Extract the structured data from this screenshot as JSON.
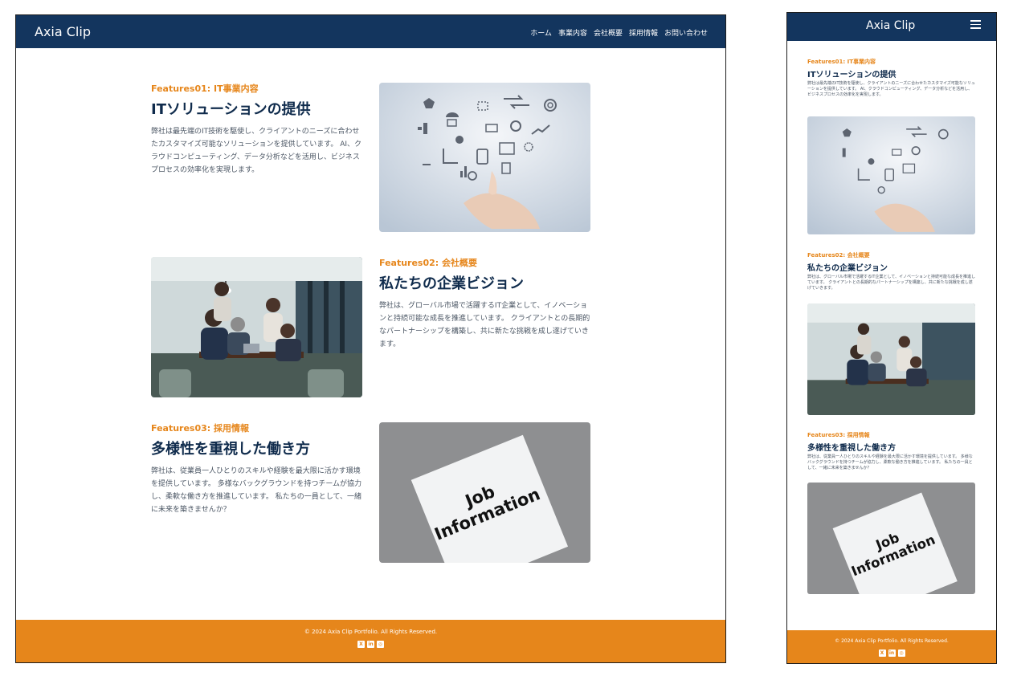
{
  "site": {
    "logo": "Axia Clip",
    "nav": [
      "ホーム",
      "事業内容",
      "会社概要",
      "採用情報",
      "お問い合わせ"
    ],
    "footer_copy": "© 2024 Axia Clip Portfolio. All Rights Reserved.",
    "social_icons": [
      "x-icon",
      "linkedin-icon",
      "github-icon"
    ]
  },
  "features": [
    {
      "kicker": "Features01: IT事業内容",
      "title": "ITソリューションの提供",
      "body": "弊社は最先端のIT技術を駆使し、クライアントのニーズに合わせたカスタマイズ可能なソリューションを提供しています。 AI、クラウドコンピューティング、データ分析などを活用し、ビジネスプロセスの効率化を実現します。",
      "image": "hand-with-tech-icons"
    },
    {
      "kicker": "Features02: 会社概要",
      "title": "私たちの企業ビジョン",
      "body": "弊社は、グローバル市場で活躍するIT企業として、イノベーションと持続可能な成長を推進しています。 クライアントとの長期的なパートナーシップを構築し、共に新たな挑戦を成し遂げていきます。",
      "image": "business-team-photo"
    },
    {
      "kicker": "Features03: 採用情報",
      "title": "多様性を重視した働き方",
      "body": "弊社は、従業員一人ひとりのスキルや経験を最大限に活かす環境を提供しています。 多様なバックグラウンドを持つチームが協力し、柔軟な働き方を推進しています。 私たちの一員として、一緒に未来を築きませんか？",
      "image": "job-information-paper",
      "image_text": [
        "Job",
        "Information"
      ]
    }
  ],
  "colors": {
    "header": "#13355e",
    "accent": "#e6861b",
    "title": "#0f2b4c",
    "text": "#4a5563"
  }
}
